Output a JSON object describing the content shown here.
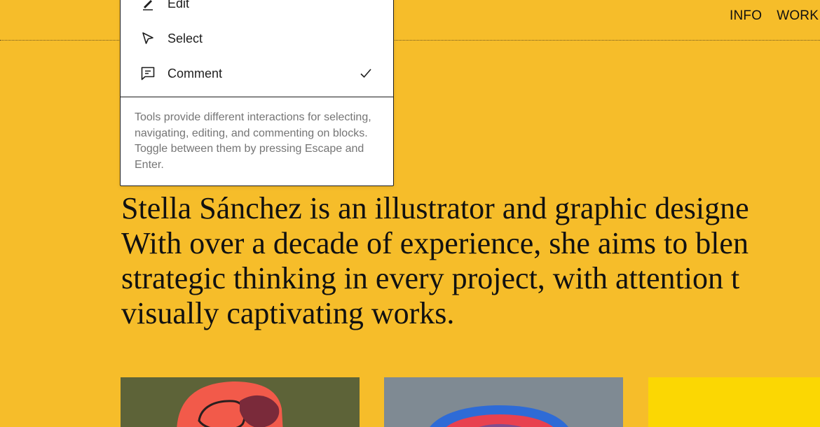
{
  "nav": {
    "items": [
      "INFO",
      "WORK"
    ]
  },
  "tools_menu": {
    "items": [
      {
        "label": "Edit",
        "icon": "pencil-icon",
        "checked": false
      },
      {
        "label": "Select",
        "icon": "cursor-icon",
        "checked": false
      },
      {
        "label": "Comment",
        "icon": "comment-icon",
        "checked": true
      }
    ],
    "help_text": "Tools provide different interactions for selecting, navigating, editing, and commenting on blocks. Toggle between them by pressing Escape and Enter."
  },
  "bio": {
    "lines": [
      "Stella Sánchez is an illustrator and graphic designe",
      "With over a decade of experience, she aims to blen",
      "strategic thinking in every project, with attention t",
      "visually captivating works."
    ]
  },
  "colors": {
    "background": "#f6bd2a",
    "menu_border": "#1e1e1e",
    "help_text": "#757575"
  }
}
